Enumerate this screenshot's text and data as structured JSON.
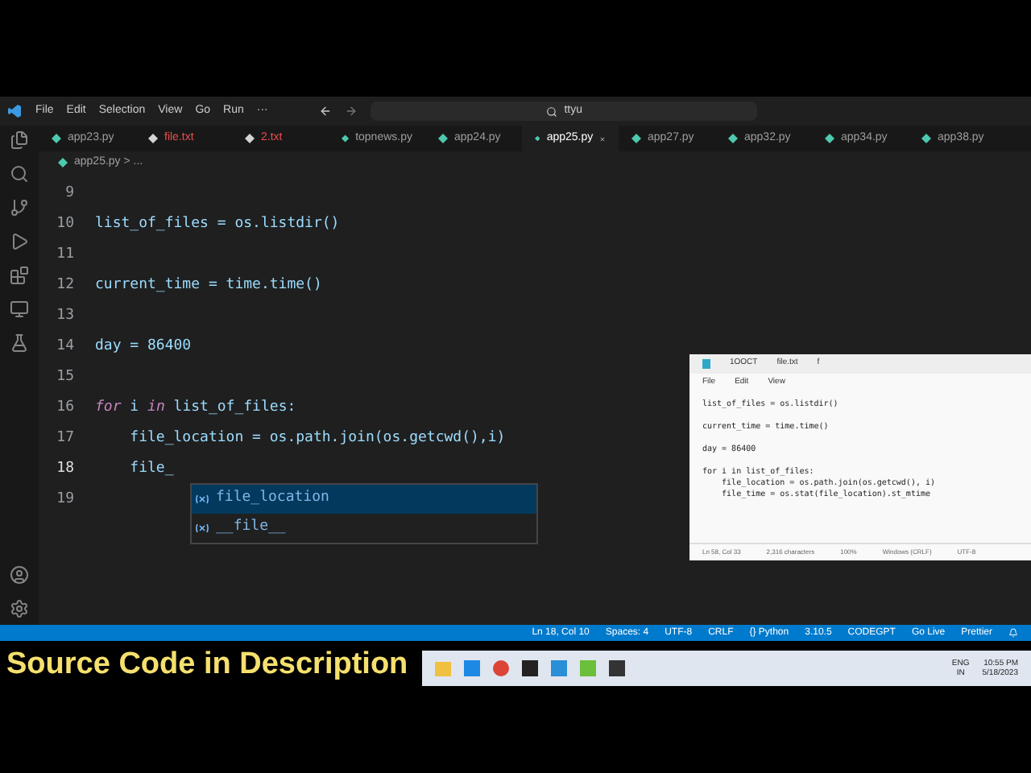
{
  "menu": [
    "File",
    "Edit",
    "Selection",
    "View",
    "Go",
    "Run",
    "···"
  ],
  "search": {
    "value": "ttyu"
  },
  "tabs": [
    {
      "label": "app23.py",
      "kind": "py",
      "selected": false
    },
    {
      "label": "file.txt",
      "kind": "txt",
      "selected": false
    },
    {
      "label": "2.txt",
      "kind": "txt",
      "selected": false
    },
    {
      "label": "topnews.py",
      "kind": "py",
      "selected": false
    },
    {
      "label": "app24.py",
      "kind": "py",
      "selected": false
    },
    {
      "label": "app25.py",
      "kind": "py",
      "selected": true
    },
    {
      "label": "app27.py",
      "kind": "py",
      "selected": false
    },
    {
      "label": "app32.py",
      "kind": "py",
      "selected": false
    },
    {
      "label": "app34.py",
      "kind": "py",
      "selected": false
    },
    {
      "label": "app38.py",
      "kind": "py",
      "selected": false
    }
  ],
  "breadcrumb": "app25.py > ...",
  "code_lines": [
    {
      "number": "9"
    },
    {
      "number": "10",
      "tokens": [
        {
          "text": "list_of_files = os.listdir()",
          "kind": "plain"
        }
      ]
    },
    {
      "number": "11"
    },
    {
      "number": "12",
      "tokens": [
        {
          "text": "current_time = time.time()",
          "kind": "plain"
        }
      ]
    },
    {
      "number": "13"
    },
    {
      "number": "14",
      "tokens": [
        {
          "text": "day = 86400",
          "kind": "plain"
        }
      ]
    },
    {
      "number": "15"
    },
    {
      "number": "16",
      "tokens": [
        {
          "text": "for",
          "kind": "keyword"
        },
        {
          "text": " i ",
          "kind": "plain"
        },
        {
          "text": "in",
          "kind": "keyword"
        },
        {
          "text": " list_of_files:",
          "kind": "plain"
        }
      ]
    },
    {
      "number": "17",
      "tokens": [
        {
          "text": "    file_location = os.path.join(os.getcwd(),i)",
          "kind": "plain"
        }
      ]
    },
    {
      "number": "18",
      "tokens": [
        {
          "text": "    file_",
          "kind": "plain"
        }
      ]
    },
    {
      "number": "19"
    }
  ],
  "suggestions": [
    {
      "label": "file_location",
      "selected": true
    },
    {
      "label": "__file__",
      "selected": false
    }
  ],
  "notepad": {
    "tabs": [
      "1OOCT",
      "file.txt",
      "f"
    ],
    "menu": [
      "File",
      "Edit",
      "View"
    ],
    "paragraphs": [
      [
        "list_of_files = os.listdir()"
      ],
      [
        "current_time = time.time()"
      ],
      [
        "day = 86400"
      ],
      [
        "for i in list_of_files:",
        "    file_location = os.path.join(os.getcwd(), i)",
        "    file_time = os.stat(file_location).st_mtime"
      ]
    ],
    "status": [
      "Ln 58, Col 33",
      "2,316 characters",
      "100%",
      "Windows (CRLF)",
      "UTF-8"
    ]
  },
  "status_bar": [
    "Ln 18, Col 10",
    "Spaces: 4",
    "UTF-8",
    "CRLF",
    "{} Python",
    "3.10.5",
    "CODEGPT",
    "Go Live",
    "Prettier"
  ],
  "caption": "Source Code in  Description",
  "tray": {
    "language": [
      "ENG",
      "IN"
    ],
    "time": "10:55 PM",
    "date": "5/18/2023"
  }
}
